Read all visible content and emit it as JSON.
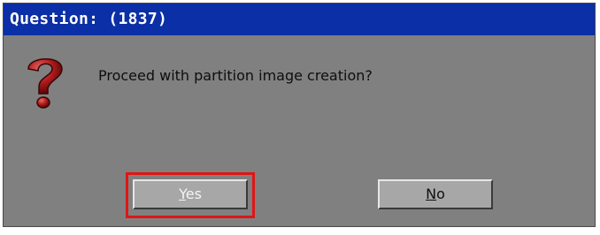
{
  "dialog": {
    "title": "Question: (1837)",
    "message": "Proceed with partition image creation?",
    "icon": "question-mark-icon"
  },
  "buttons": {
    "yes": {
      "label_first": "Y",
      "label_rest": "es",
      "focused": true
    },
    "no": {
      "label_first": "N",
      "label_rest": "o"
    }
  },
  "colors": {
    "titlebar": "#0b2fa6",
    "dialog_bg": "#808080",
    "button_face": "#a7a7a7",
    "focus_ring": "#e01515",
    "icon_red": "#b01a1a"
  }
}
